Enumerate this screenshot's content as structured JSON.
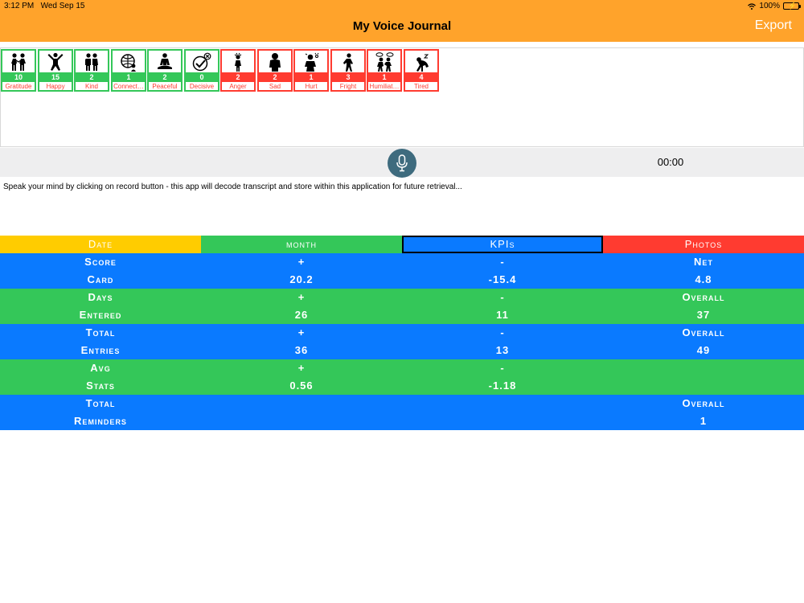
{
  "status": {
    "time": "3:12 PM",
    "date": "Wed Sep 15",
    "battery": "100%"
  },
  "header": {
    "title": "My Voice Journal",
    "export_label": "Export"
  },
  "colors": {
    "orange": "#ffa32b",
    "green": "#34c759",
    "red": "#ff3b30",
    "blue": "#0a7aff",
    "yellow": "#ffcc00",
    "mic": "#3e6b7e"
  },
  "emotions": [
    {
      "label": "Gratitude",
      "count": "10",
      "type": "pos",
      "icon": "gratitude-icon"
    },
    {
      "label": "Happy",
      "count": "15",
      "type": "pos",
      "icon": "happy-icon"
    },
    {
      "label": "Kind",
      "count": "2",
      "type": "pos",
      "icon": "kind-icon"
    },
    {
      "label": "Connect…",
      "count": "1",
      "type": "pos",
      "icon": "connected-icon"
    },
    {
      "label": "Peaceful",
      "count": "2",
      "type": "pos",
      "icon": "peaceful-icon"
    },
    {
      "label": "Decisive",
      "count": "0",
      "type": "pos",
      "icon": "decisive-icon"
    },
    {
      "label": "Anger",
      "count": "2",
      "type": "neg",
      "icon": "anger-icon"
    },
    {
      "label": "Sad",
      "count": "2",
      "type": "neg",
      "icon": "sad-icon"
    },
    {
      "label": "Hurt",
      "count": "1",
      "type": "neg",
      "icon": "hurt-icon"
    },
    {
      "label": "Fright",
      "count": "3",
      "type": "neg",
      "icon": "fright-icon"
    },
    {
      "label": "Humiliat…",
      "count": "1",
      "type": "neg",
      "icon": "humiliated-icon"
    },
    {
      "label": "Tired",
      "count": "4",
      "type": "neg",
      "icon": "tired-icon"
    }
  ],
  "recorder": {
    "timer": "00:00",
    "icon": "microphone-icon"
  },
  "prompt": "Speak your mind by clicking on record button  - this app will decode transcript and store within this application for future retrieval...",
  "tabs": [
    {
      "label": "Date",
      "color": "#ffcc00",
      "selected": false
    },
    {
      "label": "month",
      "color": "#34c759",
      "selected": false
    },
    {
      "label": "KPIs",
      "color": "#0a7aff",
      "selected": true
    },
    {
      "label": "Photos",
      "color": "#ff3b30",
      "selected": false
    }
  ],
  "kpi_rows": [
    {
      "color": "#0a7aff",
      "cols": [
        [
          "Score",
          "Card"
        ],
        [
          "+",
          "20.2"
        ],
        [
          "-",
          "-15.4"
        ],
        [
          "Net",
          "4.8"
        ]
      ]
    },
    {
      "color": "#34c759",
      "cols": [
        [
          "Days",
          "Entered"
        ],
        [
          "+",
          "26"
        ],
        [
          "-",
          "11"
        ],
        [
          "Overall",
          "37"
        ]
      ]
    },
    {
      "color": "#0a7aff",
      "cols": [
        [
          "Total",
          "Entries"
        ],
        [
          "+",
          "36"
        ],
        [
          "-",
          "13"
        ],
        [
          "Overall",
          "49"
        ]
      ]
    },
    {
      "color": "#34c759",
      "cols": [
        [
          "Avg",
          "Stats"
        ],
        [
          "+",
          "0.56"
        ],
        [
          "-",
          "-1.18"
        ],
        [
          "",
          ""
        ]
      ]
    },
    {
      "color": "#0a7aff",
      "cols": [
        [
          "Total",
          "Reminders"
        ],
        [
          "",
          ""
        ],
        [
          "",
          ""
        ],
        [
          "Overall",
          "1"
        ]
      ]
    }
  ]
}
